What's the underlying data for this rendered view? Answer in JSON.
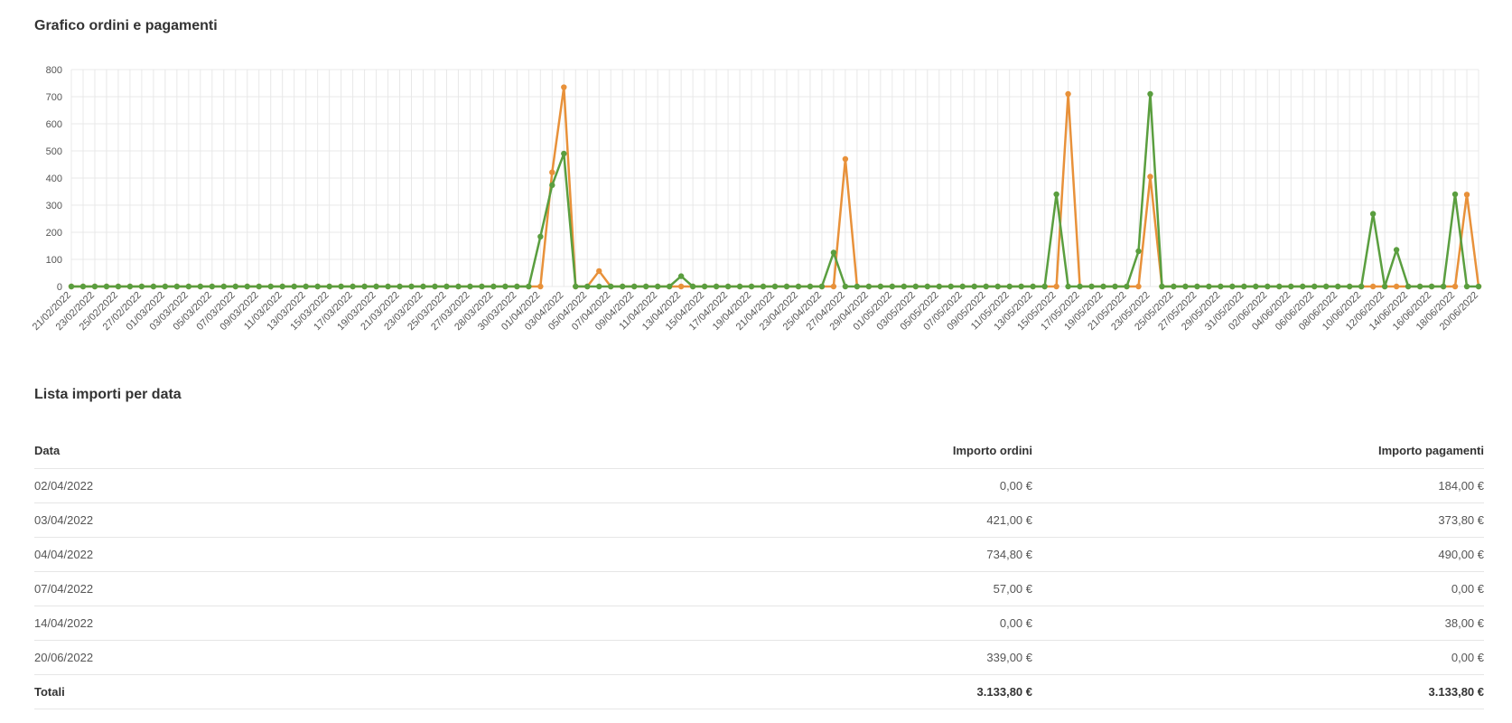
{
  "chart_title": "Grafico ordini e pagamenti",
  "chart_data": {
    "type": "line",
    "title": "Grafico ordini e pagamenti",
    "xlabel": "",
    "ylabel": "",
    "ylim": [
      0,
      800
    ],
    "yticks": [
      0,
      100,
      200,
      300,
      400,
      500,
      600,
      700,
      800
    ],
    "grid": true,
    "legend": "none",
    "start_date": "2022-02-21",
    "end_date": "2022-06-21",
    "x_tick_labels": [
      "21/02/2022",
      "23/02/2022",
      "25/02/2022",
      "27/02/2022",
      "01/03/2022",
      "03/03/2022",
      "05/03/2022",
      "07/03/2022",
      "09/03/2022",
      "11/03/2022",
      "13/03/2022",
      "15/03/2022",
      "17/03/2022",
      "19/03/2022",
      "21/03/2022",
      "23/03/2022",
      "25/03/2022",
      "27/03/2022",
      "28/03/2022",
      "30/03/2022",
      "01/04/2022",
      "03/04/2022",
      "05/04/2022",
      "07/04/2022",
      "09/04/2022",
      "11/04/2022",
      "13/04/2022",
      "15/04/2022",
      "17/04/2022",
      "19/04/2022",
      "21/04/2022",
      "23/04/2022",
      "25/04/2022",
      "27/04/2022",
      "29/04/2022",
      "01/05/2022",
      "03/05/2022",
      "05/05/2022",
      "07/05/2022",
      "09/05/2022",
      "11/05/2022",
      "13/05/2022",
      "15/05/2022",
      "17/05/2022",
      "19/05/2022",
      "21/05/2022",
      "23/05/2022",
      "25/05/2022",
      "27/05/2022",
      "29/05/2022",
      "31/05/2022",
      "02/06/2022",
      "04/06/2022",
      "06/06/2022",
      "08/06/2022",
      "10/06/2022",
      "12/06/2022",
      "14/06/2022",
      "16/06/2022",
      "18/06/2022",
      "20/06/2022"
    ],
    "series": [
      {
        "color": "#e8913a",
        "nonzero_points": [
          {
            "x": "2022-04-03",
            "y": 421
          },
          {
            "x": "2022-04-04",
            "y": 734.8
          },
          {
            "x": "2022-04-07",
            "y": 57
          },
          {
            "x": "2022-04-28",
            "y": 470
          },
          {
            "x": "2022-05-17",
            "y": 710
          },
          {
            "x": "2022-05-24",
            "y": 405
          },
          {
            "x": "2022-06-20",
            "y": 339
          }
        ]
      },
      {
        "color": "#5a9e3f",
        "nonzero_points": [
          {
            "x": "2022-04-02",
            "y": 184
          },
          {
            "x": "2022-04-03",
            "y": 373.8
          },
          {
            "x": "2022-04-04",
            "y": 490
          },
          {
            "x": "2022-04-14",
            "y": 38
          },
          {
            "x": "2022-04-27",
            "y": 125
          },
          {
            "x": "2022-05-16",
            "y": 340
          },
          {
            "x": "2022-05-23",
            "y": 130
          },
          {
            "x": "2022-05-24",
            "y": 710
          },
          {
            "x": "2022-06-12",
            "y": 268
          },
          {
            "x": "2022-06-14",
            "y": 135
          },
          {
            "x": "2022-06-19",
            "y": 340
          }
        ]
      }
    ],
    "colors": {
      "grid": "#e8e8e8",
      "axis_text": "#555555"
    }
  },
  "table": {
    "title": "Lista importi per data",
    "headers": {
      "date": "Data",
      "orders": "Importo ordini",
      "payments": "Importo pagamenti"
    },
    "rows": [
      {
        "date": "02/04/2022",
        "orders": "0,00 €",
        "payments": "184,00 €"
      },
      {
        "date": "03/04/2022",
        "orders": "421,00 €",
        "payments": "373,80 €"
      },
      {
        "date": "04/04/2022",
        "orders": "734,80 €",
        "payments": "490,00 €"
      },
      {
        "date": "07/04/2022",
        "orders": "57,00 €",
        "payments": "0,00 €"
      },
      {
        "date": "14/04/2022",
        "orders": "0,00 €",
        "payments": "38,00 €"
      },
      {
        "date": "20/06/2022",
        "orders": "339,00 €",
        "payments": "0,00 €"
      }
    ],
    "totals": {
      "label": "Totali",
      "orders": "3.133,80 €",
      "payments": "3.133,80 €"
    }
  }
}
